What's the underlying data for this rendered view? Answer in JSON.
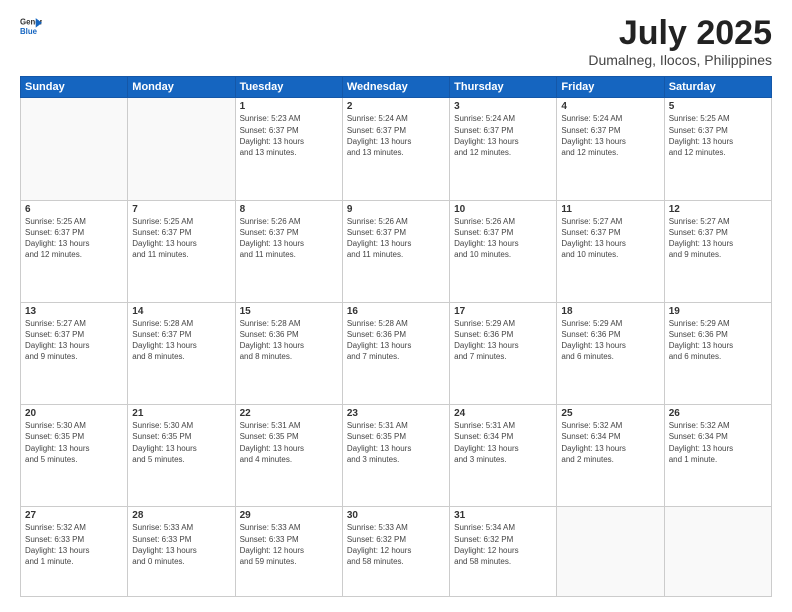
{
  "logo": {
    "line1": "General",
    "line2": "Blue"
  },
  "title": "July 2025",
  "subtitle": "Dumalneg, Ilocos, Philippines",
  "header": {
    "days": [
      "Sunday",
      "Monday",
      "Tuesday",
      "Wednesday",
      "Thursday",
      "Friday",
      "Saturday"
    ]
  },
  "weeks": [
    [
      {
        "day": "",
        "info": ""
      },
      {
        "day": "",
        "info": ""
      },
      {
        "day": "1",
        "info": "Sunrise: 5:23 AM\nSunset: 6:37 PM\nDaylight: 13 hours\nand 13 minutes."
      },
      {
        "day": "2",
        "info": "Sunrise: 5:24 AM\nSunset: 6:37 PM\nDaylight: 13 hours\nand 13 minutes."
      },
      {
        "day": "3",
        "info": "Sunrise: 5:24 AM\nSunset: 6:37 PM\nDaylight: 13 hours\nand 12 minutes."
      },
      {
        "day": "4",
        "info": "Sunrise: 5:24 AM\nSunset: 6:37 PM\nDaylight: 13 hours\nand 12 minutes."
      },
      {
        "day": "5",
        "info": "Sunrise: 5:25 AM\nSunset: 6:37 PM\nDaylight: 13 hours\nand 12 minutes."
      }
    ],
    [
      {
        "day": "6",
        "info": "Sunrise: 5:25 AM\nSunset: 6:37 PM\nDaylight: 13 hours\nand 12 minutes."
      },
      {
        "day": "7",
        "info": "Sunrise: 5:25 AM\nSunset: 6:37 PM\nDaylight: 13 hours\nand 11 minutes."
      },
      {
        "day": "8",
        "info": "Sunrise: 5:26 AM\nSunset: 6:37 PM\nDaylight: 13 hours\nand 11 minutes."
      },
      {
        "day": "9",
        "info": "Sunrise: 5:26 AM\nSunset: 6:37 PM\nDaylight: 13 hours\nand 11 minutes."
      },
      {
        "day": "10",
        "info": "Sunrise: 5:26 AM\nSunset: 6:37 PM\nDaylight: 13 hours\nand 10 minutes."
      },
      {
        "day": "11",
        "info": "Sunrise: 5:27 AM\nSunset: 6:37 PM\nDaylight: 13 hours\nand 10 minutes."
      },
      {
        "day": "12",
        "info": "Sunrise: 5:27 AM\nSunset: 6:37 PM\nDaylight: 13 hours\nand 9 minutes."
      }
    ],
    [
      {
        "day": "13",
        "info": "Sunrise: 5:27 AM\nSunset: 6:37 PM\nDaylight: 13 hours\nand 9 minutes."
      },
      {
        "day": "14",
        "info": "Sunrise: 5:28 AM\nSunset: 6:37 PM\nDaylight: 13 hours\nand 8 minutes."
      },
      {
        "day": "15",
        "info": "Sunrise: 5:28 AM\nSunset: 6:36 PM\nDaylight: 13 hours\nand 8 minutes."
      },
      {
        "day": "16",
        "info": "Sunrise: 5:28 AM\nSunset: 6:36 PM\nDaylight: 13 hours\nand 7 minutes."
      },
      {
        "day": "17",
        "info": "Sunrise: 5:29 AM\nSunset: 6:36 PM\nDaylight: 13 hours\nand 7 minutes."
      },
      {
        "day": "18",
        "info": "Sunrise: 5:29 AM\nSunset: 6:36 PM\nDaylight: 13 hours\nand 6 minutes."
      },
      {
        "day": "19",
        "info": "Sunrise: 5:29 AM\nSunset: 6:36 PM\nDaylight: 13 hours\nand 6 minutes."
      }
    ],
    [
      {
        "day": "20",
        "info": "Sunrise: 5:30 AM\nSunset: 6:35 PM\nDaylight: 13 hours\nand 5 minutes."
      },
      {
        "day": "21",
        "info": "Sunrise: 5:30 AM\nSunset: 6:35 PM\nDaylight: 13 hours\nand 5 minutes."
      },
      {
        "day": "22",
        "info": "Sunrise: 5:31 AM\nSunset: 6:35 PM\nDaylight: 13 hours\nand 4 minutes."
      },
      {
        "day": "23",
        "info": "Sunrise: 5:31 AM\nSunset: 6:35 PM\nDaylight: 13 hours\nand 3 minutes."
      },
      {
        "day": "24",
        "info": "Sunrise: 5:31 AM\nSunset: 6:34 PM\nDaylight: 13 hours\nand 3 minutes."
      },
      {
        "day": "25",
        "info": "Sunrise: 5:32 AM\nSunset: 6:34 PM\nDaylight: 13 hours\nand 2 minutes."
      },
      {
        "day": "26",
        "info": "Sunrise: 5:32 AM\nSunset: 6:34 PM\nDaylight: 13 hours\nand 1 minute."
      }
    ],
    [
      {
        "day": "27",
        "info": "Sunrise: 5:32 AM\nSunset: 6:33 PM\nDaylight: 13 hours\nand 1 minute."
      },
      {
        "day": "28",
        "info": "Sunrise: 5:33 AM\nSunset: 6:33 PM\nDaylight: 13 hours\nand 0 minutes."
      },
      {
        "day": "29",
        "info": "Sunrise: 5:33 AM\nSunset: 6:33 PM\nDaylight: 12 hours\nand 59 minutes."
      },
      {
        "day": "30",
        "info": "Sunrise: 5:33 AM\nSunset: 6:32 PM\nDaylight: 12 hours\nand 58 minutes."
      },
      {
        "day": "31",
        "info": "Sunrise: 5:34 AM\nSunset: 6:32 PM\nDaylight: 12 hours\nand 58 minutes."
      },
      {
        "day": "",
        "info": ""
      },
      {
        "day": "",
        "info": ""
      }
    ]
  ]
}
